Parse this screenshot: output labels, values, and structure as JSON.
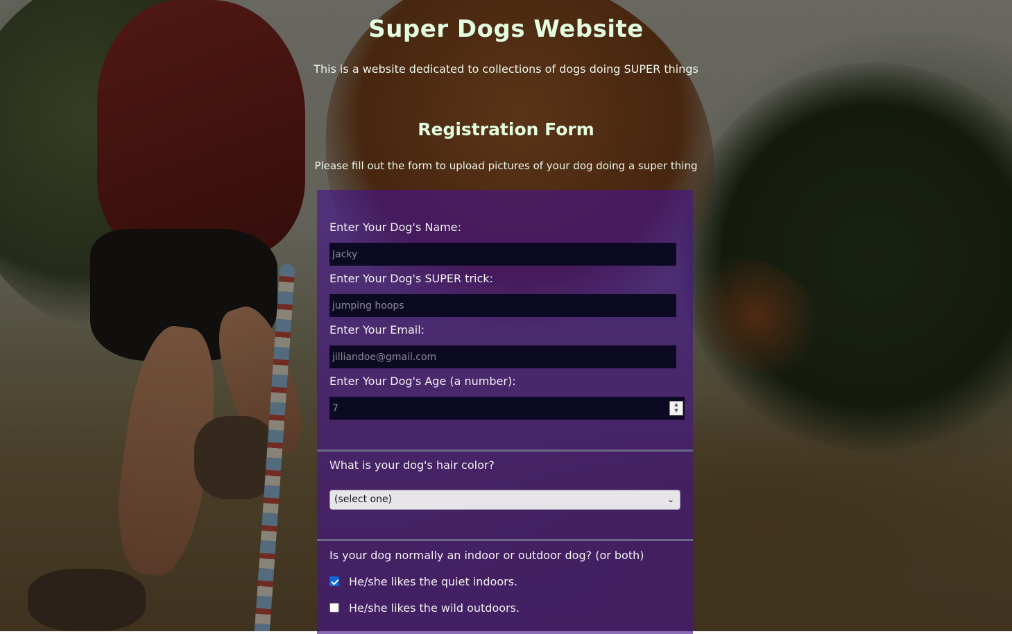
{
  "header": {
    "title": "Super Dogs Website",
    "description": "This is a website dedicated to collections of dogs doing SUPER things"
  },
  "registration": {
    "title": "Registration Form",
    "description": "Please fill out the form to upload pictures of your dog doing a super thing"
  },
  "form": {
    "name_label": "Enter Your Dog's Name:",
    "name_placeholder": "Jacky",
    "trick_label": "Enter Your Dog's SUPER trick:",
    "trick_placeholder": "jumping hoops",
    "email_label": "Enter Your Email:",
    "email_placeholder": "jilliandoe@gmail.com",
    "age_label": "Enter Your Dog's Age (a number):",
    "age_placeholder": "7",
    "hair_question": "What is your dog's hair color?",
    "hair_select_value": "(select one)",
    "environment_question": "Is your dog normally an indoor or outdoor dog? (or both)",
    "options": [
      {
        "label": "He/she likes the quiet indoors.",
        "checked": true
      },
      {
        "label": "He/she likes the wild outdoors.",
        "checked": false
      }
    ]
  },
  "colors": {
    "heading": "#e3fde0",
    "panel": "#46148c",
    "checkbox_accent": "#1467d6"
  }
}
